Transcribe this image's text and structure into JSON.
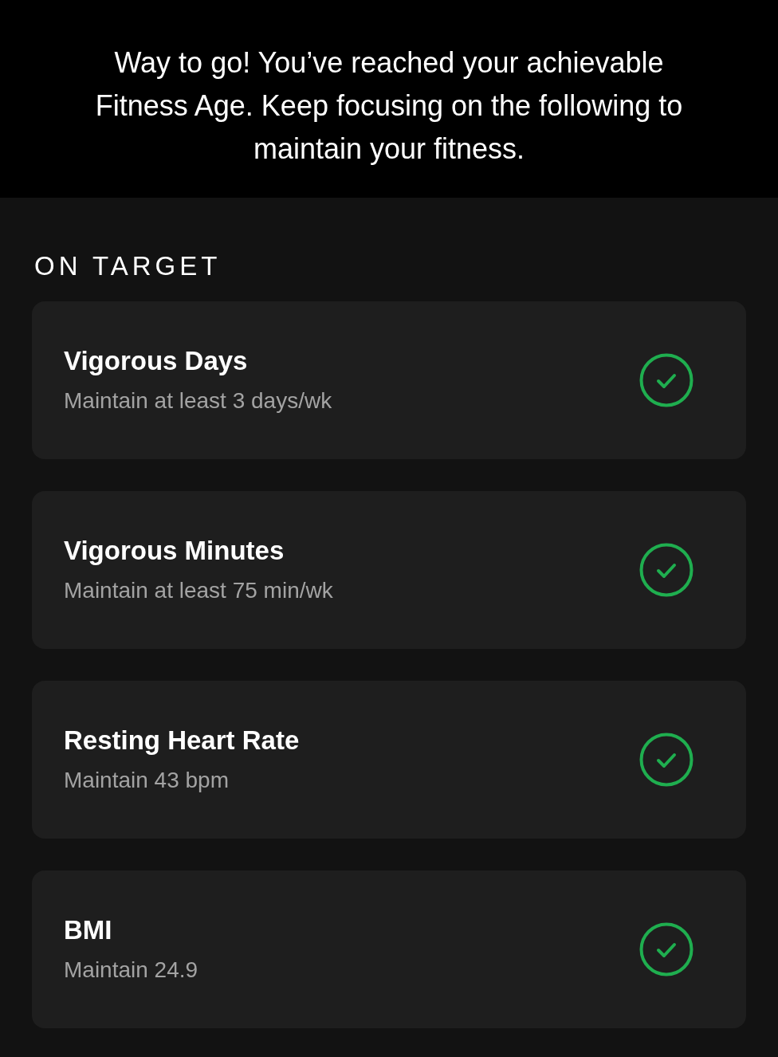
{
  "banner": {
    "message": "Way to go! You’ve reached your achievable Fitness Age. Keep focusing on the following to maintain your fitness."
  },
  "section": {
    "title": "ON TARGET",
    "items": [
      {
        "title": "Vigorous Days",
        "subtitle": "Maintain at least 3 days/wk",
        "achieved": true
      },
      {
        "title": "Vigorous Minutes",
        "subtitle": "Maintain at least 75 min/wk",
        "achieved": true
      },
      {
        "title": "Resting Heart Rate",
        "subtitle": "Maintain 43 bpm",
        "achieved": true
      },
      {
        "title": "BMI",
        "subtitle": "Maintain 24.9",
        "achieved": true
      }
    ]
  }
}
